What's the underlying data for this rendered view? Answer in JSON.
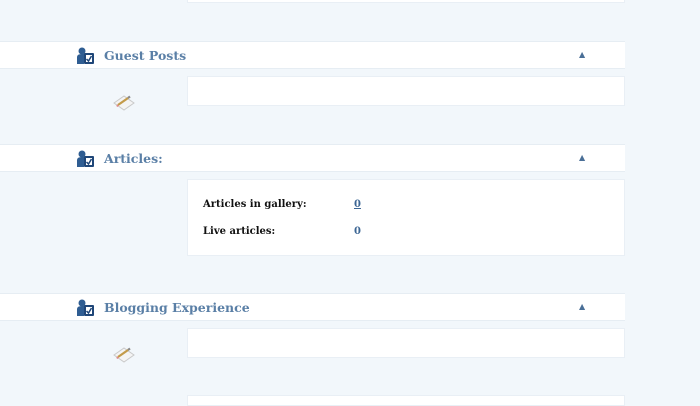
{
  "sections": [
    {
      "title": "Guest Posts",
      "toggle": "▲"
    },
    {
      "title": "Articles:",
      "toggle": "▲"
    },
    {
      "title": "Blogging Experience",
      "toggle": "▲"
    }
  ],
  "articles": {
    "stats": [
      {
        "label": "Articles in gallery:",
        "value": "0"
      },
      {
        "label": "Live articles:",
        "value": "0"
      }
    ]
  },
  "icons": {
    "section_icon": "user-profile-icon",
    "edit_icon": "edit-pencil-icon"
  },
  "colors": {
    "background": "#f2f7fb",
    "panel": "#ffffff",
    "title": "#5a7fa6",
    "accent": "#2f5d92"
  }
}
